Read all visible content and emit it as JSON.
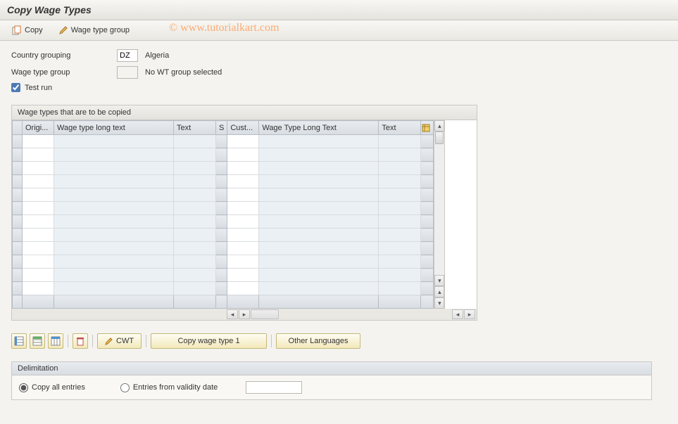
{
  "title": "Copy Wage Types",
  "toolbar": {
    "copy_label": "Copy",
    "wage_group_label": "Wage type group"
  },
  "watermark": "© www.tutorialkart.com",
  "fields": {
    "country_grouping_label": "Country grouping",
    "country_grouping_value": "DZ",
    "country_grouping_text": "Algeria",
    "wage_type_group_label": "Wage type group",
    "wage_type_group_value": "",
    "wage_type_group_text": "No WT group selected",
    "test_run_label": "Test run"
  },
  "grid": {
    "title": "Wage types that are to be copied",
    "columns": {
      "origi": "Origi...",
      "long_text1": "Wage type long text",
      "text1": "Text",
      "s": "S",
      "cust": "Cust...",
      "long_text2": "Wage Type Long Text",
      "text2": "Text"
    }
  },
  "buttons": {
    "cwt": "CWT",
    "copy_wt1": "Copy wage type 1",
    "other_langs": "Other Languages"
  },
  "delimitation": {
    "header": "Delimitation",
    "copy_all": "Copy all entries",
    "entries_from": "Entries from validity date"
  }
}
